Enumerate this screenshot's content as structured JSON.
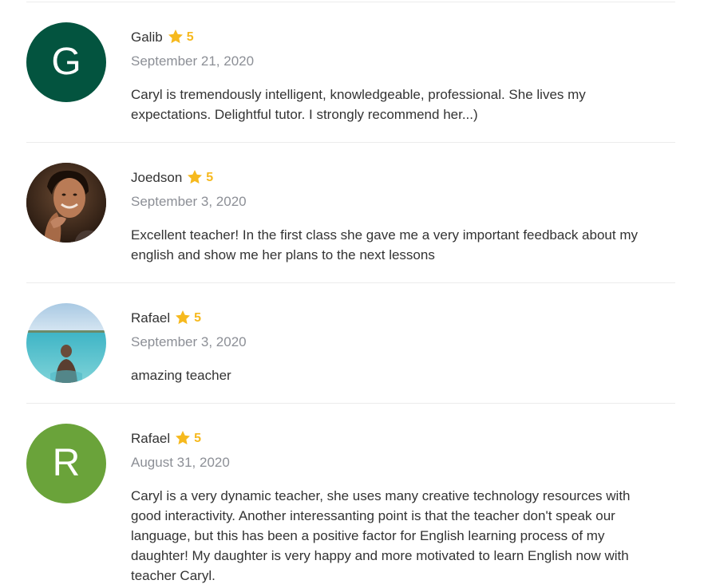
{
  "reviews": [
    {
      "name": "Galib",
      "rating": "5",
      "date": "September 21, 2020",
      "text": "Caryl is tremendously intelligent, knowledgeable, professional. She lives my expectations. Delightful tutor. I strongly recommend her...)",
      "avatar": {
        "type": "letter",
        "letter": "G",
        "color": "#03543f"
      }
    },
    {
      "name": "Joedson",
      "rating": "5",
      "date": "September 3, 2020",
      "text": "Excellent teacher! In the first class she gave me a very important feedback about my english and show me her plans to the next lessons",
      "avatar": {
        "type": "photo",
        "subject": "young man smiling with hand on chin"
      }
    },
    {
      "name": "Rafael",
      "rating": "5",
      "date": "September 3, 2020",
      "text": "amazing teacher",
      "avatar": {
        "type": "photo",
        "subject": "person standing in turquoise sea"
      }
    },
    {
      "name": "Rafael",
      "rating": "5",
      "date": "August 31, 2020",
      "text": "Caryl is a very dynamic teacher, she uses many creative technology resources with good interactivity. Another interessanting point is that the teacher don't speak our language, but this has been a positive factor for English learning process of my daughter! My daughter is very happy and more motivated to learn English now with teacher Caryl.",
      "avatar": {
        "type": "letter",
        "letter": "R",
        "color": "#6aa33a"
      }
    }
  ],
  "icons": {
    "rating": "star-icon",
    "star_color": "#f6b91e"
  }
}
